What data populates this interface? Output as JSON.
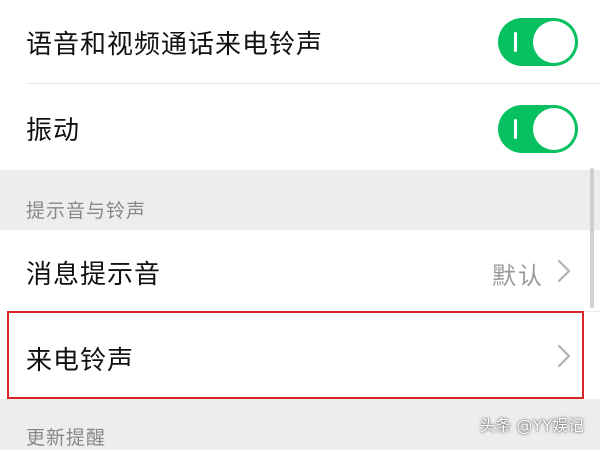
{
  "settings": {
    "call_ringtone_toggle": {
      "label": "语音和视频通话来电铃声",
      "on": true
    },
    "vibration_toggle": {
      "label": "振动",
      "on": true
    },
    "section_sounds": {
      "title": "提示音与铃声"
    },
    "message_tone": {
      "label": "消息提示音",
      "value": "默认"
    },
    "ringtone": {
      "label": "来电铃声"
    },
    "section_updates": {
      "title": "更新提醒"
    }
  },
  "colors": {
    "toggle_on": "#07c160",
    "highlight": "#d9262b"
  },
  "icons": {
    "chevron": "chevron-right-icon",
    "toggle_knob": "toggle-knob"
  },
  "watermark": {
    "text": "头条 @YY娱记"
  }
}
